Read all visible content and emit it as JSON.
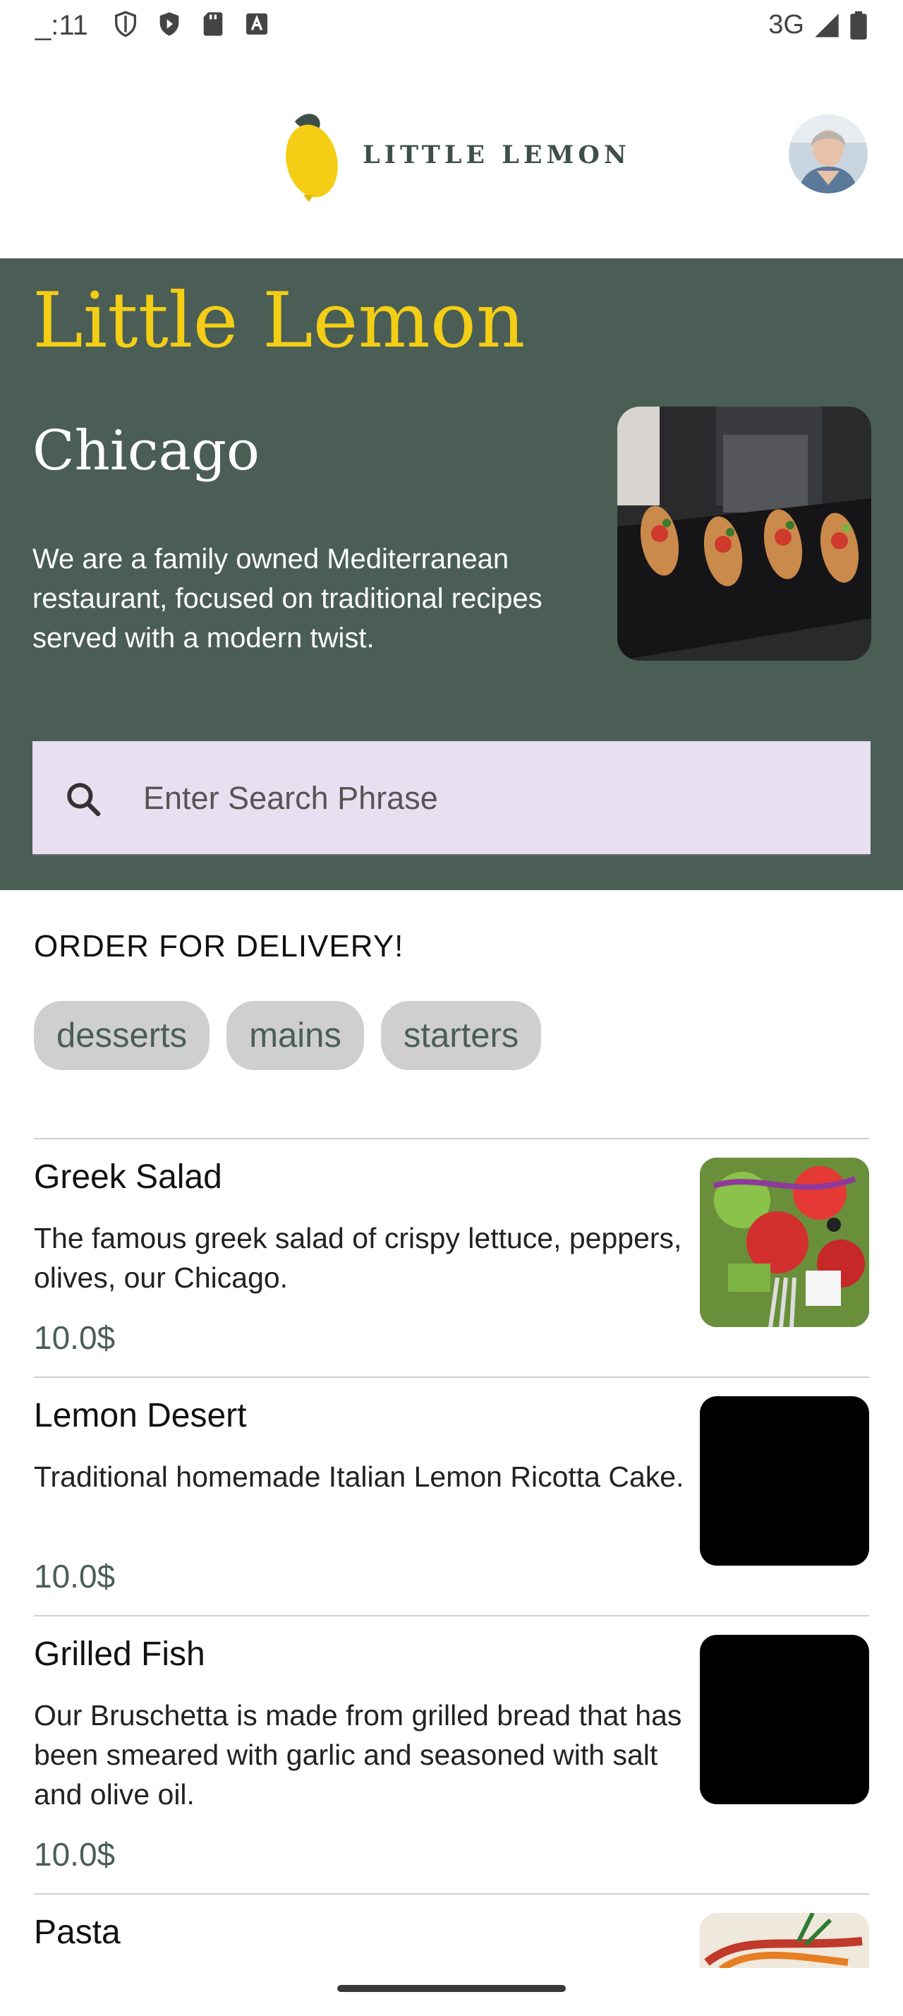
{
  "status_bar": {
    "time": "_:11",
    "network": "3G"
  },
  "header": {
    "logo_text": "LITTLE LEMON"
  },
  "hero": {
    "title": "Little Lemon",
    "city": "Chicago",
    "description": "We are a family owned Mediterranean restaurant, focused on traditional recipes served with a modern twist.",
    "search_placeholder": "Enter Search Phrase"
  },
  "order": {
    "title": "ORDER FOR DELIVERY!",
    "categories": [
      "desserts",
      "mains",
      "starters"
    ]
  },
  "menu": [
    {
      "name": "Greek Salad",
      "description": "The famous greek salad of crispy lettuce, peppers, olives, our Chicago.",
      "price": "10.0$"
    },
    {
      "name": "Lemon Desert",
      "description": "Traditional homemade Italian Lemon Ricotta Cake.",
      "price": "10.0$"
    },
    {
      "name": "Grilled Fish",
      "description": "Our Bruschetta is made from grilled bread that has been smeared with garlic and seasoned with salt and olive oil.",
      "price": "10.0$"
    },
    {
      "name": "Pasta"
    }
  ],
  "colors": {
    "brand_green": "#4a5e56",
    "brand_yellow": "#f4ce14",
    "search_bg": "#e8dff0",
    "chip_bg": "#cfcfcf"
  }
}
